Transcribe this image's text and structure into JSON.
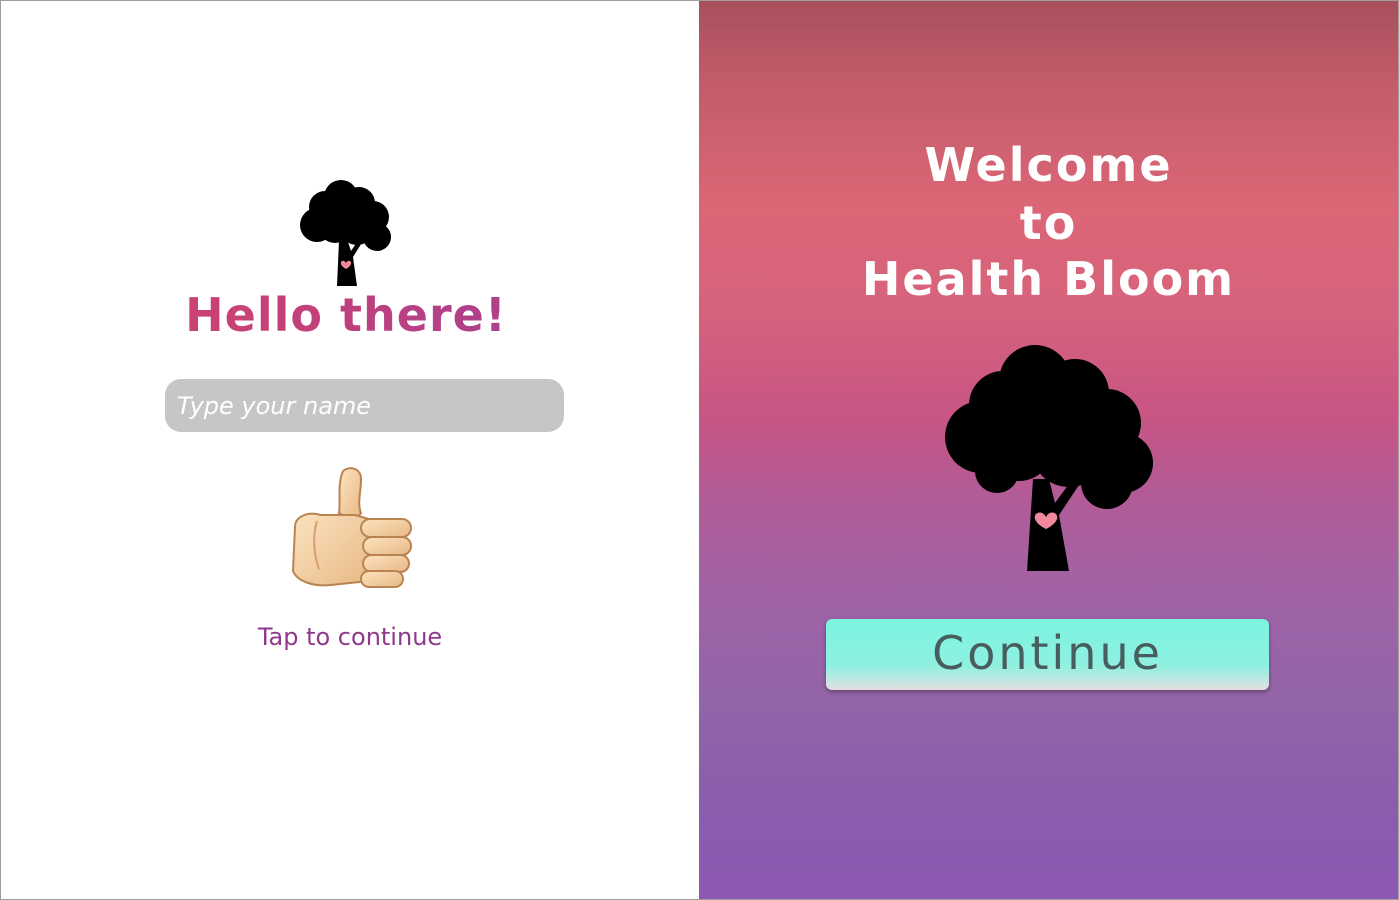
{
  "left_screen": {
    "greeting": "Hello there!",
    "name_input": {
      "value": "",
      "placeholder": "Type your name"
    },
    "thumbs_up_icon": "thumbs-up-emoji",
    "tap_text": "Tap to continue",
    "tree_icon": "tree-with-heart-icon"
  },
  "right_screen": {
    "welcome_line1": "Welcome",
    "welcome_line2": "to",
    "welcome_line3": "Health Bloom",
    "tree_icon": "tree-with-heart-icon",
    "continue_label": "Continue"
  },
  "colors": {
    "greeting_gradient_start": "#d9436a",
    "greeting_gradient_end": "#9a3f9f",
    "tap_text": "#8e3a8c",
    "input_background": "#c6c6c6",
    "right_gradient_top": "#a84f5c",
    "right_gradient_mid": "#dc6676",
    "right_gradient_bottom": "#8e58b5",
    "continue_button": "#7af4e0",
    "continue_text": "#485e5e",
    "heart": "#f08a9a"
  }
}
